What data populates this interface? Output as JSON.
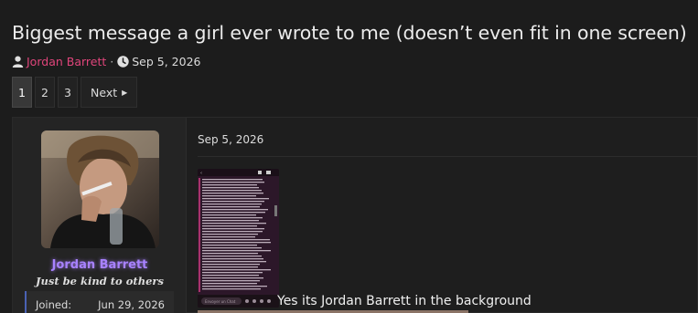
{
  "thread": {
    "title": "Biggest message a girl ever wrote to me (doesn’t even fit in one screen)",
    "author": "Jordan Barrett",
    "separator": "·",
    "date": "Sep 5, 2026"
  },
  "pagination": {
    "pages": [
      "1",
      "2",
      "3"
    ],
    "current": "1",
    "next_label": "Next",
    "next_icon": "caret-right-icon"
  },
  "post": {
    "user": {
      "name": "Jordan Barrett",
      "title": "Just be kind to others",
      "name_color": "#a882ff",
      "joined_label": "Joined:",
      "joined_value": "Jun 29, 2026"
    },
    "date": "Sep 5, 2026",
    "attachment": {
      "chat_placeholder": "Envoyer un Chat"
    },
    "caption": "Yes its Jordan Barrett in the background"
  },
  "colors": {
    "author_link": "#e0457b",
    "background": "#1c1c1c",
    "accent_border": "#4a62b4"
  },
  "icons": {
    "author": "user-icon",
    "date": "clock-icon"
  }
}
